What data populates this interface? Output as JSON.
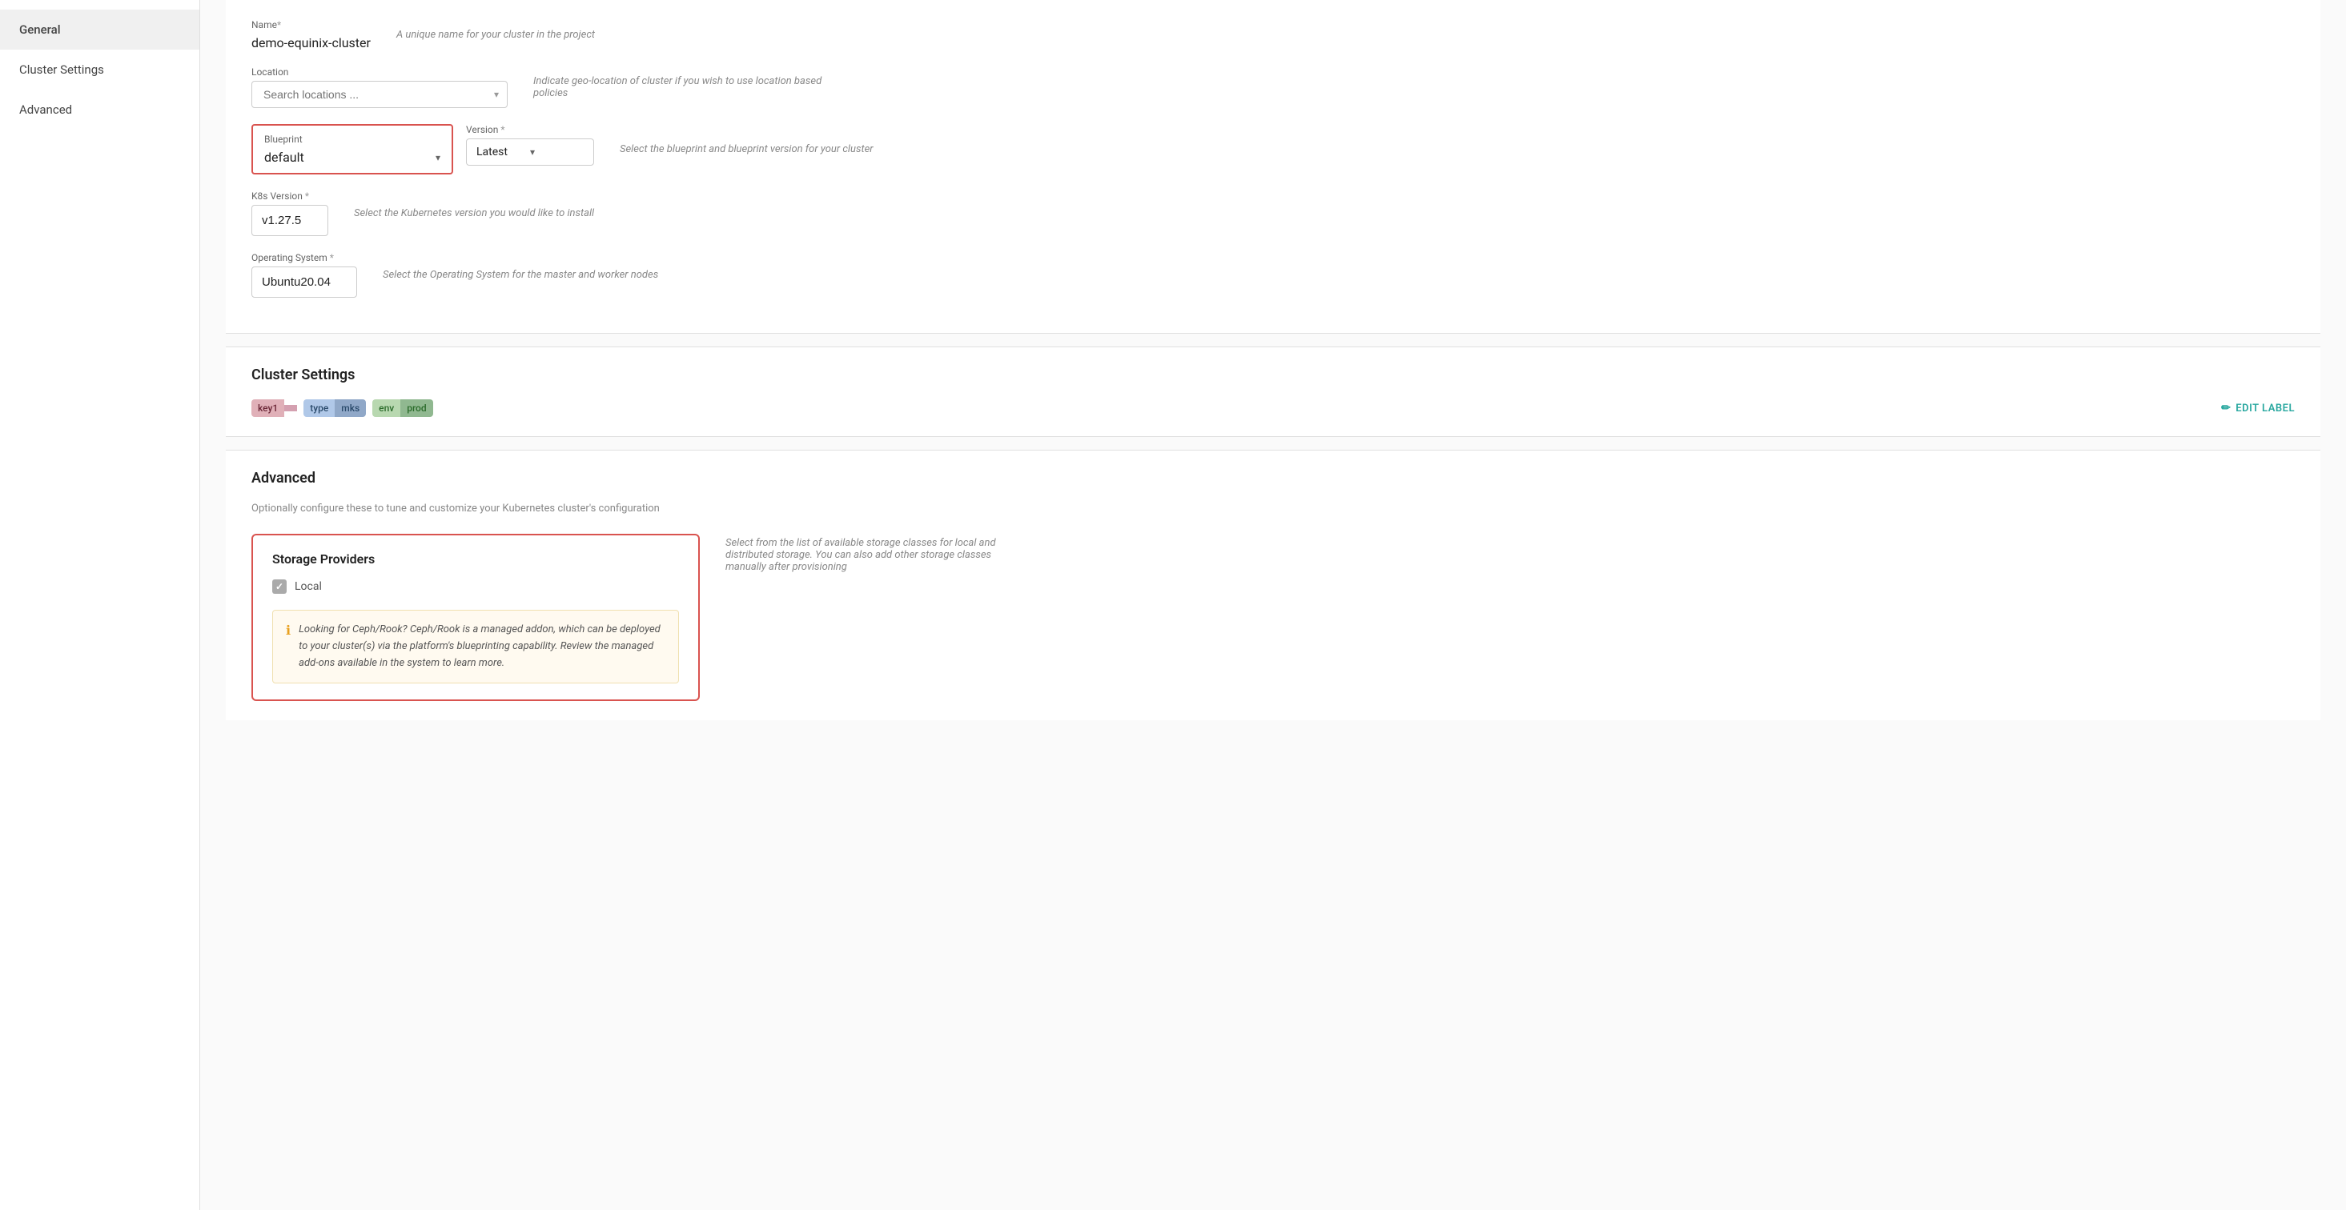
{
  "sidebar": {
    "items": [
      {
        "id": "general",
        "label": "General",
        "active": true
      },
      {
        "id": "cluster-settings",
        "label": "Cluster Settings",
        "active": false
      },
      {
        "id": "advanced",
        "label": "Advanced",
        "active": false
      }
    ]
  },
  "form": {
    "name": {
      "label": "Name",
      "required": "*",
      "value": "demo-equinix-cluster",
      "helper": "A unique name for your cluster in the project"
    },
    "location": {
      "label": "Location",
      "placeholder": "Search locations ...",
      "helper": "Indicate geo-location of cluster if you wish to use location based policies"
    },
    "blueprint": {
      "label": "Blueprint",
      "value": "default",
      "helper": ""
    },
    "version": {
      "label": "Version",
      "required": "*",
      "value": "Latest",
      "helper": "Select the blueprint and blueprint version for your cluster"
    },
    "k8s_version": {
      "label": "K8s Version",
      "required": "*",
      "value": "v1.27.5",
      "helper": "Select the Kubernetes version you would like to install"
    },
    "operating_system": {
      "label": "Operating System",
      "required": "*",
      "value": "Ubuntu20.04",
      "helper": "Select the Operating System for the master and worker nodes"
    }
  },
  "cluster_settings": {
    "title": "Cluster Settings",
    "labels": [
      {
        "key": "key1",
        "value": "",
        "style": "pink"
      },
      {
        "key": "type",
        "value": "mks",
        "style": "blue"
      },
      {
        "key": "env",
        "value": "prod",
        "style": "green"
      }
    ],
    "edit_label": "EDIT LABEL"
  },
  "advanced": {
    "title": "Advanced",
    "subtitle": "Optionally configure these to tune and customize your Kubernetes cluster's configuration",
    "storage_providers": {
      "title": "Storage Providers",
      "local_label": "Local",
      "local_checked": true,
      "info_text": "Looking for Ceph/Rook? Ceph/Rook is a managed addon, which can be deployed to your cluster(s) via the platform's blueprinting capability. Review the managed add-ons available in the system to learn more.",
      "helper": "Select from the list of available storage classes for local and distributed storage. You can also add other storage classes manually after provisioning"
    }
  }
}
